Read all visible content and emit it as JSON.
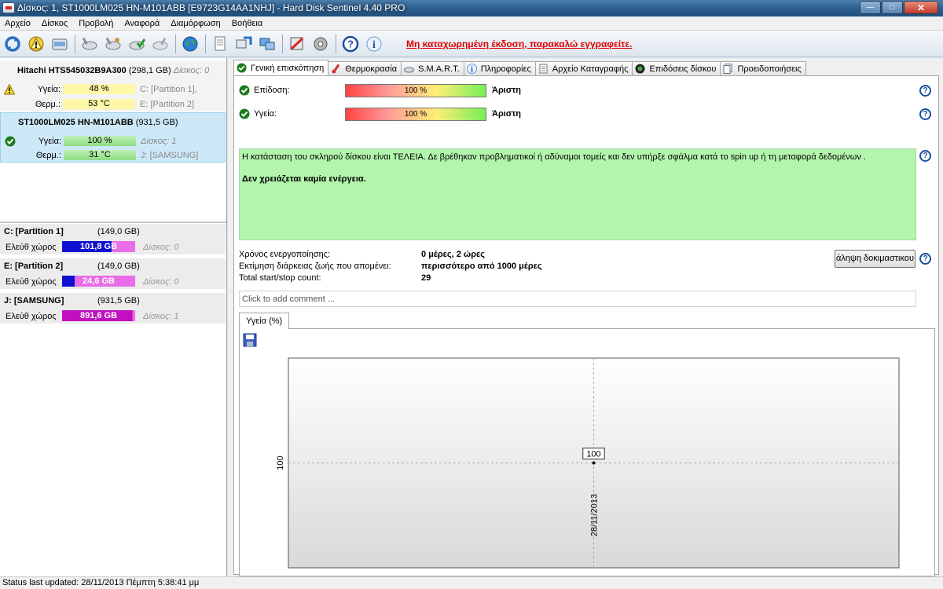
{
  "window": {
    "title": "Δίσκος: 1, ST1000LM025 HN-M101ABB [E9723G14AA1NHJ]  -  Hard Disk Sentinel 4.40 PRO",
    "buttons": {
      "minimize": "—",
      "maximize": "□",
      "close": "✕"
    }
  },
  "menu": [
    "Αρχείο",
    "Δίσκος",
    "Προβολή",
    "Αναφορά",
    "Διαμόρφωση",
    "Βοήθεια"
  ],
  "toolbar": {
    "icons": [
      "refresh-icon",
      "warning-icon",
      "disk-icon",
      "disk-tool-icon",
      "disk-tool-2-icon",
      "disk-tool-3-icon",
      "disk-tool-4-icon",
      "globe-icon",
      "report-icon",
      "transfer-icon",
      "network-icon",
      "test-icon",
      "settings-icon",
      "help-icon",
      "info-icon"
    ],
    "notice": "Μη καταχωρημένη έκδοση, παρακαλώ εγγραφείτε."
  },
  "disks": [
    {
      "name": "Hitachi HTS545032B9A300",
      "size": "(298,1 GB)",
      "disk_label": "Δίσκος: 0",
      "status_icon": "warning-icon",
      "health_label": "Υγεία:",
      "health_value": "48 %",
      "temp_label": "Θερμ.:",
      "temp_value": "53 °C",
      "partitions": [
        "C: [Partition 1],",
        "E: [Partition 2]"
      ]
    },
    {
      "name": "ST1000LM025 HN-M101ABB",
      "size": "(931,5 GB)",
      "disk_label": "Δίσκος: 1",
      "status_icon": "check-icon",
      "health_label": "Υγεία:",
      "health_value": "100 %",
      "temp_label": "Θερμ.:",
      "temp_value": "31 °C",
      "partitions": [
        "J: [SAMSUNG]"
      ]
    }
  ],
  "partitions": [
    {
      "name": "C: [Partition 1]",
      "size": "(149,0 GB)",
      "free_label": "Ελεύθ χώρος",
      "free": "101,8 GB",
      "free_fraction": 0.68,
      "disk": "Δίσκος: 0",
      "color": "#1010d0"
    },
    {
      "name": "E: [Partition 2]",
      "size": "(149,0 GB)",
      "free_label": "Ελεύθ χώρος",
      "free": "24,6 GB",
      "free_fraction": 0.165,
      "disk": "Δίσκος: 0",
      "color": "#1010d0"
    },
    {
      "name": "J: [SAMSUNG]",
      "size": "(931,5 GB)",
      "free_label": "Ελεύθ χώρος",
      "free": "891,6 GB",
      "free_fraction": 0.957,
      "disk": "Δίσκος: 1",
      "color": "#c010c0"
    }
  ],
  "tabs": [
    {
      "label": "Γενική επισκόπηση",
      "icon": "check-icon",
      "active": true
    },
    {
      "label": "Θερμοκρασία",
      "icon": "thermometer-icon"
    },
    {
      "label": "S.M.A.R.T.",
      "icon": "smart-icon"
    },
    {
      "label": "Πληροφορίες",
      "icon": "info-icon"
    },
    {
      "label": "Αρχείο Καταγραφής",
      "icon": "log-icon"
    },
    {
      "label": "Επιδόσεις δίσκου",
      "icon": "performance-icon"
    },
    {
      "label": "Προειδοποιήσεις",
      "icon": "alerts-icon"
    }
  ],
  "overview": {
    "performance": {
      "label": "Επίδοση:",
      "value": "100 %",
      "rating": "Άριστη"
    },
    "health": {
      "label": "Υγεία:",
      "value": "100 %",
      "rating": "Άριστη"
    },
    "summary": "Η κατάσταση του σκληρού δίσκου είναι ΤΕΛΕΙΑ. Δε βρέθηκαν προβληματικοί ή αδύναμοι τομείς και δεν υπήρξε σφάλμα κατά το spin up ή τη μεταφορά δεδομένων .",
    "action": "Δεν χρειάζεται καμία ενέργεια.",
    "info": [
      {
        "key": "Χρόνος ενεργοποίησης:",
        "value": "0 μέρες, 2 ώρες"
      },
      {
        "key": "Εκτίμηση διάρκειας ζωής που απομένει:",
        "value": "περισσότερο από 1000 μέρες"
      },
      {
        "key": "Total start/stop count:",
        "value": "29"
      }
    ],
    "test_button": "άληψη δοκιμαστικου",
    "comment_placeholder": "Click to add comment ..."
  },
  "chart_tab": "Υγεία (%)",
  "chart_data": {
    "type": "line",
    "title": "",
    "x": [
      "28/11/2013"
    ],
    "series": [
      {
        "values": [
          100
        ]
      }
    ],
    "y_tick_labels": [
      "100"
    ],
    "data_labels": [
      "100"
    ],
    "grid": true
  },
  "statusbar": "Status last updated: 28/11/2013 Πέμπτη 5:38:41 μμ"
}
